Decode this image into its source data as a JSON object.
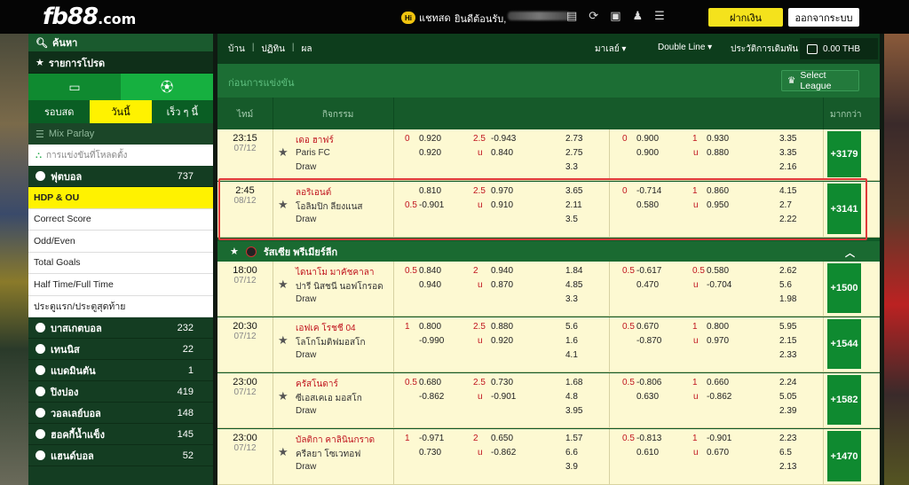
{
  "header": {
    "logo_main": "fb88",
    "logo_domain": ".com",
    "chat_badge": "Hi",
    "chat_label": "แชทสด",
    "welcome_prefix": "ยินดีต้อนรับ,",
    "icons": [
      "statement-icon",
      "refresh-icon",
      "odds-icon",
      "profile-icon",
      "betlist-icon"
    ],
    "deposit_label": "ฝากเงิน",
    "logout_label": "ออกจากระบบ"
  },
  "sidebar": {
    "search_label": "ค้นหา",
    "favorites_label": "รายการโปรด",
    "tabs": [
      {
        "label": "รอบสด",
        "active": false
      },
      {
        "label": "วันนี้",
        "active": true
      },
      {
        "label": "เร็ว ๆ นี้",
        "active": false
      }
    ],
    "mix_parlay": "Mix Parlay",
    "parlay_sub": "การแข่งขันที่โหลดตั้ง",
    "football": {
      "name": "ฟุตบอล",
      "count": "737"
    },
    "bet_types": [
      {
        "label": "HDP & OU",
        "active": true
      },
      {
        "label": "Correct Score",
        "active": false
      },
      {
        "label": "Odd/Even",
        "active": false
      },
      {
        "label": "Total Goals",
        "active": false
      },
      {
        "label": "Half Time/Full Time",
        "active": false
      },
      {
        "label": "ประตูแรก/ประตูสุดท้าย",
        "active": false
      }
    ],
    "sports": [
      {
        "name": "บาสเกตบอล",
        "count": "232"
      },
      {
        "name": "เทนนิส",
        "count": "22"
      },
      {
        "name": "แบดมินตัน",
        "count": "1"
      },
      {
        "name": "ปิงปอง",
        "count": "419"
      },
      {
        "name": "วอลเลย์บอล",
        "count": "148"
      },
      {
        "name": "ฮอคกี้น้ำแข็ง",
        "count": "145"
      },
      {
        "name": "แฮนด์บอล",
        "count": "52"
      }
    ]
  },
  "nav": {
    "breadcrumbs": [
      "บ้าน",
      "ปฏิทิน",
      "ผล"
    ],
    "market_label": "มาเลย์",
    "line_label": "Double Line",
    "history_label": "ประวัติการเดิมพัน",
    "balance": "0.00 THB"
  },
  "section_title": "ก่อนการแข่งขัน",
  "select_league_label": "Select League",
  "columns": {
    "time": "ไทม์",
    "event": "กิจกรรม",
    "more": "มากกว่า"
  },
  "league_name": "รัสเซีย พรีเมียร์ลีก",
  "matches": [
    {
      "time": "23:15",
      "date": "07/12",
      "home": "เดอ ฮาฟร์",
      "away": "Paris FC",
      "draw": "Draw",
      "ft_hdp_line": "0",
      "ft_home": "0.920",
      "ft_away": "0.920",
      "ft_ou_line": "2.5",
      "ft_over": "-0.943",
      "ft_under": "0.840",
      "ft_1x2": [
        "2.73",
        "2.75",
        "3.3"
      ],
      "ht_hdp_line": "0",
      "ht_home": "0.900",
      "ht_away": "0.900",
      "ht_ou_line": "1",
      "ht_over": "0.930",
      "ht_under": "0.880",
      "ht_1x2": [
        "3.35",
        "3.35",
        "2.16"
      ],
      "more": "+3179"
    },
    {
      "time": "2:45",
      "date": "08/12",
      "home": "ลอริเอนต์",
      "away": "โอลิมปิก ลียงแนส",
      "draw": "Draw",
      "ft_hdp_line": "0.5",
      "ft_home": "0.810",
      "ft_away": "-0.901",
      "ft_ou_line": "2.5",
      "ft_over": "0.970",
      "ft_under": "0.910",
      "ft_1x2": [
        "3.65",
        "2.11",
        "3.5"
      ],
      "ht_hdp_line": "0",
      "ht_home": "-0.714",
      "ht_away": "0.580",
      "ht_ou_line": "1",
      "ht_over": "0.860",
      "ht_under": "0.950",
      "ht_1x2": [
        "4.15",
        "2.7",
        "2.22"
      ],
      "more": "+3141"
    },
    {
      "time": "18:00",
      "date": "07/12",
      "home": "ไดนาโม มาคัชคาลา",
      "away": "ปารี นิสชนี นอฟโกรอด",
      "draw": "Draw",
      "ft_hdp_line": "0.5",
      "ft_home": "0.840",
      "ft_away": "0.940",
      "ft_ou_line": "2",
      "ft_over": "0.940",
      "ft_under": "0.870",
      "ft_1x2": [
        "1.84",
        "4.85",
        "3.3"
      ],
      "ht_hdp_line": "0.5",
      "ht_home": "-0.617",
      "ht_away": "0.470",
      "ht_ou_line": "0.5",
      "ht_over": "0.580",
      "ht_under": "-0.704",
      "ht_1x2": [
        "2.62",
        "5.6",
        "1.98"
      ],
      "more": "+1500"
    },
    {
      "time": "20:30",
      "date": "07/12",
      "home": "เอฟเค โรชชี 04",
      "away": "โลโกโมติฟมอสโก",
      "draw": "Draw",
      "ft_hdp_line": "1",
      "ft_home": "0.800",
      "ft_away": "-0.990",
      "ft_ou_line": "2.5",
      "ft_over": "0.880",
      "ft_under": "0.920",
      "ft_1x2": [
        "5.6",
        "1.6",
        "4.1"
      ],
      "ht_hdp_line": "0.5",
      "ht_home": "0.670",
      "ht_away": "-0.870",
      "ht_ou_line": "1",
      "ht_over": "0.800",
      "ht_under": "0.970",
      "ht_1x2": [
        "5.95",
        "2.15",
        "2.33"
      ],
      "more": "+1544"
    },
    {
      "time": "23:00",
      "date": "07/12",
      "home": "ครัสโนดาร์",
      "away": "ซีเอสเคเอ มอสโก",
      "draw": "Draw",
      "ft_hdp_line": "0.5",
      "ft_home": "0.680",
      "ft_away": "-0.862",
      "ft_ou_line": "2.5",
      "ft_over": "0.730",
      "ft_under": "-0.901",
      "ft_1x2": [
        "1.68",
        "4.8",
        "3.95"
      ],
      "ht_hdp_line": "0.5",
      "ht_home": "-0.806",
      "ht_away": "0.630",
      "ht_ou_line": "1",
      "ht_over": "0.660",
      "ht_under": "-0.862",
      "ht_1x2": [
        "2.24",
        "5.05",
        "2.39"
      ],
      "more": "+1582"
    },
    {
      "time": "23:00",
      "date": "07/12",
      "home": "บัลติกา คาลินินกราด",
      "away": "ครีลยา โซเวทอฟ",
      "draw": "Draw",
      "ft_hdp_line": "1",
      "ft_home": "-0.971",
      "ft_away": "0.730",
      "ft_ou_line": "2",
      "ft_over": "0.650",
      "ft_under": "-0.862",
      "ft_1x2": [
        "1.57",
        "6.6",
        "3.9"
      ],
      "ht_hdp_line": "0.5",
      "ht_home": "-0.813",
      "ht_away": "0.610",
      "ht_ou_line": "1",
      "ht_over": "-0.901",
      "ht_under": "0.670",
      "ht_1x2": [
        "2.23",
        "6.5",
        "2.13"
      ],
      "more": "+1470"
    }
  ]
}
